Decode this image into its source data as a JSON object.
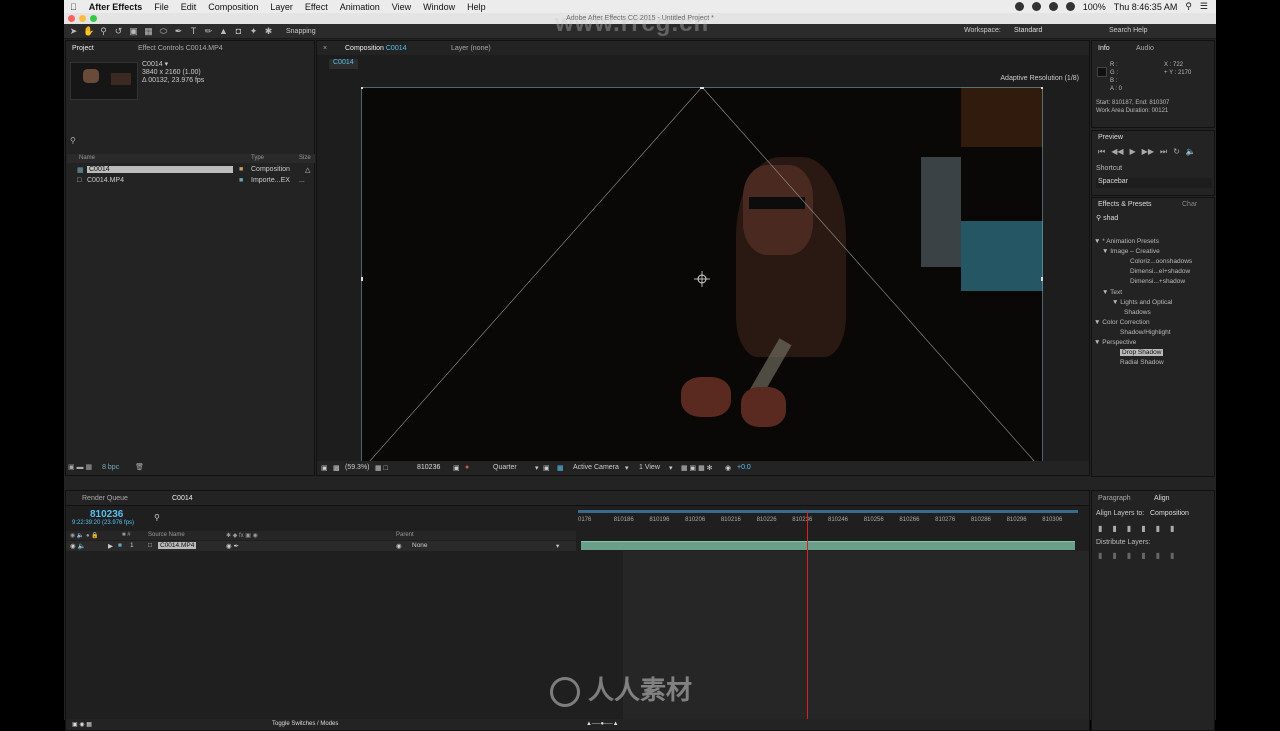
{
  "menubar": {
    "app": "After Effects",
    "items": [
      "File",
      "Edit",
      "Composition",
      "Layer",
      "Effect",
      "Animation",
      "View",
      "Window",
      "Help"
    ],
    "battery": "100%",
    "clock": "Thu 8:46:35 AM"
  },
  "window": {
    "title": "Adobe After Effects CC 2015 - Untitled Project *"
  },
  "toolbar": {
    "snapping": "Snapping",
    "workspace_label": "Workspace:",
    "workspace_value": "Standard",
    "search": "Search Help"
  },
  "project": {
    "tab_project": "Project",
    "tab_effect_controls": "Effect Controls C0014.MP4",
    "item_name": "C0014 ▾",
    "item_res": "3840 x 2160 (1.00)",
    "item_dur": "Δ 00132, 23.976 fps",
    "search_icon": "search-icon",
    "col_name": "Name",
    "col_type": "Type",
    "col_size": "Size",
    "rows": [
      {
        "name": "C0014",
        "type": "Composition"
      },
      {
        "name": "C0014.MP4",
        "type": "Importe...EX",
        "size": "..."
      }
    ],
    "bpc": "8 bpc"
  },
  "comp": {
    "tab_comp": "Composition",
    "tab_comp_name": "C0014",
    "tab_layer": "Layer (none)",
    "subtab": "C0014",
    "adaptive": "Adaptive Resolution (1/8)",
    "zoom": "(59.3%)",
    "timecode": "810236",
    "resolution": "Quarter",
    "camera": "Active Camera",
    "views": "1 View",
    "exposure": "+0.0"
  },
  "info": {
    "tab_info": "Info",
    "tab_audio": "Audio",
    "r": "R :",
    "g": "G :",
    "b": "B :",
    "a": "A : 0",
    "x": "X : 722",
    "y": "Y : 2170",
    "start_end": "Start: 810187, End: 810307",
    "work_area": "Work Area Duration: 00121"
  },
  "preview": {
    "title": "Preview",
    "shortcut_label": "Shortcut",
    "shortcut_value": "Spacebar"
  },
  "effects": {
    "title": "Effects & Presets",
    "title2": "Char",
    "search": "shad",
    "tree": [
      "▼ * Animation Presets",
      "▼ Image – Creative",
      "Coloriz...oonshadows",
      "Dimensi...el+shadow",
      "Dimensi...+shadow",
      "▼ Text",
      "▼ Lights and Optical",
      "Shadows",
      "▼ Color Correction",
      "Shadow/Highlight",
      "▼ Perspective",
      "Drop Shadow",
      "Radial Shadow"
    ]
  },
  "timeline": {
    "tab_render": "Render Queue",
    "tab_comp": "C0014",
    "timecode": "810236",
    "timecode_sub": "9:22:39:20 (23.976 fps)",
    "col_source": "Source Name",
    "col_parent": "Parent",
    "layer_num": "1",
    "layer_name": "C0014.MP4",
    "parent_value": "None",
    "ruler": [
      "0176",
      "810186",
      "810196",
      "810206",
      "810216",
      "810226",
      "810236",
      "810246",
      "810256",
      "810266",
      "810276",
      "810286",
      "810296",
      "810306"
    ],
    "footer": "Toggle Switches / Modes"
  },
  "align": {
    "tab_paragraph": "Paragraph",
    "tab_align": "Align",
    "align_to_label": "Align Layers to:",
    "align_to_value": "Composition",
    "distribute": "Distribute Layers:"
  },
  "watermark": {
    "top": "www.rrcg.cn",
    "bottom": "人人素材"
  }
}
